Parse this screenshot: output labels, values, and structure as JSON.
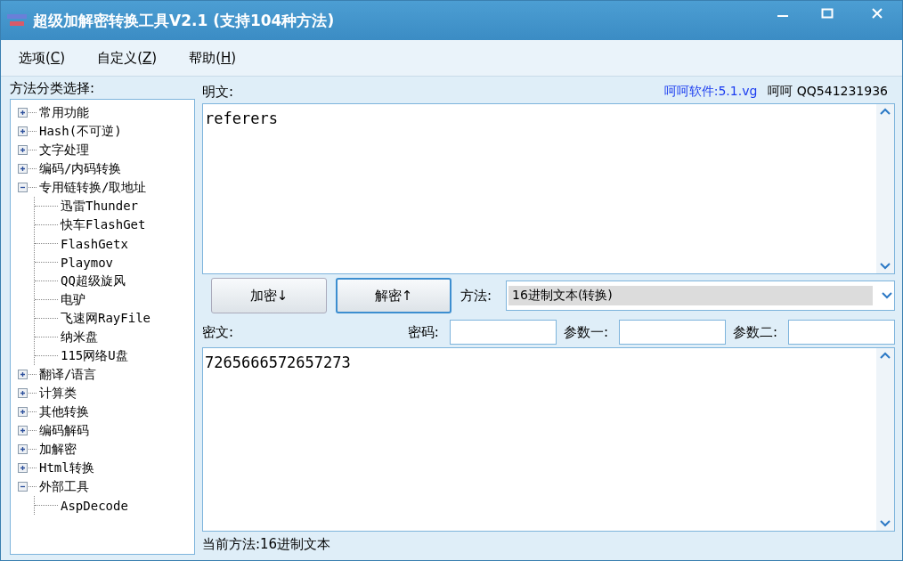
{
  "window": {
    "title": "超级加解密转换工具V2.1 (支持104种方法)"
  },
  "menu": [
    {
      "before": "选项(",
      "mnemonic": "C",
      "after": ")"
    },
    {
      "before": "自定义(",
      "mnemonic": "Z",
      "after": ")"
    },
    {
      "before": "帮助(",
      "mnemonic": "H",
      "after": ")"
    }
  ],
  "sidebar": {
    "label": "方法分类选择:",
    "tree": [
      {
        "label": "常用功能",
        "expanded": false
      },
      {
        "label": "Hash(不可逆)",
        "expanded": false
      },
      {
        "label": "文字处理",
        "expanded": false
      },
      {
        "label": "编码/内码转换",
        "expanded": false
      },
      {
        "label": "专用链转换/取地址",
        "expanded": true,
        "children": [
          {
            "label": "迅雷Thunder"
          },
          {
            "label": "快车FlashGet"
          },
          {
            "label": "FlashGetx"
          },
          {
            "label": "Playmov"
          },
          {
            "label": "QQ超级旋风"
          },
          {
            "label": "电驴"
          },
          {
            "label": "飞速网RayFile"
          },
          {
            "label": "纳米盘"
          },
          {
            "label": "115网络U盘"
          }
        ]
      },
      {
        "label": "翻译/语言",
        "expanded": false
      },
      {
        "label": "计算类",
        "expanded": false
      },
      {
        "label": "其他转换",
        "expanded": false
      },
      {
        "label": "编码解码",
        "expanded": false
      },
      {
        "label": "加解密",
        "expanded": false
      },
      {
        "label": "Html转换",
        "expanded": false
      },
      {
        "label": "外部工具",
        "expanded": true,
        "children": [
          {
            "label": "AspDecode"
          }
        ]
      }
    ]
  },
  "plaintext": {
    "label": "明文:",
    "link": "呵呵软件:5.1.vg",
    "credit": "呵呵 QQ541231936",
    "value": "referers"
  },
  "buttons": [
    {
      "label": "加密↓",
      "focused": false
    },
    {
      "label": "解密↑",
      "focused": true
    }
  ],
  "method": {
    "label": "方法:",
    "value": "16进制文本(转换)"
  },
  "ciphertext": {
    "label": "密文:",
    "fields": [
      {
        "label": "密码:"
      },
      {
        "label": "参数一:"
      },
      {
        "label": "参数二:"
      }
    ],
    "value": "7265666572657273"
  },
  "status_bar": {
    "text": "当前方法:16进制文本"
  }
}
